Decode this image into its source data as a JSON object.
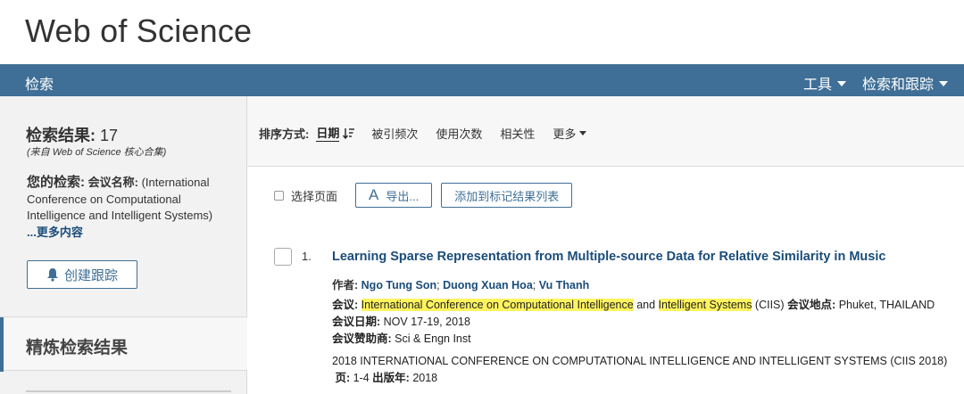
{
  "app": {
    "title": "Web of Science"
  },
  "nav": {
    "search": "检索",
    "tools": "工具",
    "track": "检索和跟踪"
  },
  "sidebar": {
    "results_label": "检索结果:",
    "results_count": "17",
    "source_note": "(来自 Web of Science 核心合集)",
    "your_search_label": "您的检索:",
    "query_label": "会议名称:",
    "query_text": "(International Conference on Computational Intelligence and Intelligent Systems)",
    "more_label": "...更多内容",
    "create_alert": "创建跟踪",
    "refine_title": "精炼检索结果"
  },
  "sort": {
    "label": "排序方式:",
    "active": "日期",
    "options": [
      "被引频次",
      "使用次数",
      "相关性"
    ],
    "more": "更多"
  },
  "toolbar": {
    "select_page": "选择页面",
    "export": "导出...",
    "add_marked": "添加到标记结果列表"
  },
  "record": {
    "number": "1.",
    "title": "Learning Sparse Representation from Multiple-source Data for Relative Similarity in Music",
    "authors_label": "作者:",
    "authors": [
      "Ngo Tung Son",
      "Duong Xuan Hoa",
      "Vu Thanh"
    ],
    "author_sep": "; ",
    "conf_label": "会议:",
    "conf_hl1": "International Conference on Computational Intelligence",
    "conf_and": " and ",
    "conf_hl2": "Intelligent Systems",
    "conf_abbr": " (CIIS) ",
    "location_label": "会议地点:",
    "location": " Phuket, THAILAND ",
    "date_label": "会议日期:",
    "date": " NOV 17-19, 2018",
    "sponsor_label": "会议赞助商:",
    "sponsor": " Sci & Engn Inst",
    "proceedings": "2018 INTERNATIONAL CONFERENCE ON COMPUTATIONAL INTELLIGENCE AND INTELLIGENT SYSTEMS (CIIS 2018)",
    "pages_label": "页:",
    "pages": " 1-4 ",
    "year_label": "出版年:",
    "year": " 2018"
  },
  "colors": {
    "nav": "#3f6f96",
    "link": "#1a4c7a",
    "highlight": "#fff35f"
  },
  "icons": [
    "bell-icon",
    "sort-descending-icon",
    "caret-down-icon",
    "export-icon"
  ]
}
